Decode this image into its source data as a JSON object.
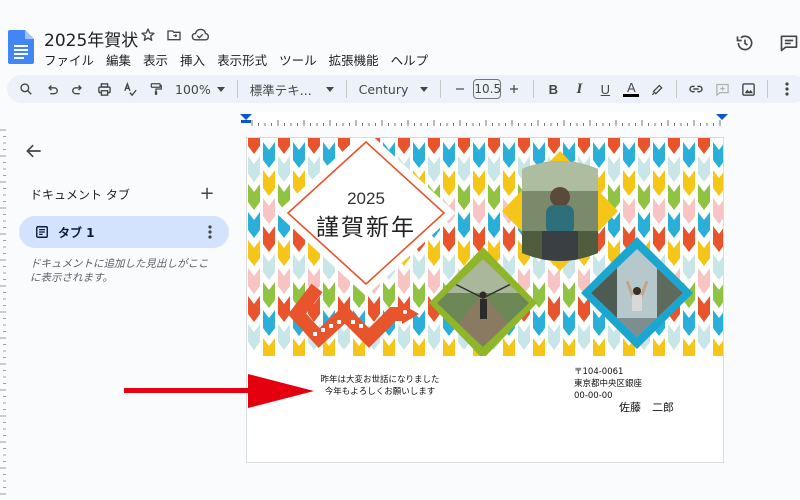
{
  "doc": {
    "title": "2025年賀状",
    "menus": [
      "ファイル",
      "編集",
      "表示",
      "挿入",
      "表示形式",
      "ツール",
      "拡張機能",
      "ヘルプ"
    ],
    "title_icons": [
      "star-icon",
      "move-to-folder-icon",
      "cloud-saved-icon"
    ],
    "right_icons": [
      "history-icon",
      "comments-icon"
    ]
  },
  "toolbar": {
    "zoom": "100%",
    "style": "標準テキ...",
    "font": "Century",
    "font_size": "10.5",
    "bold": "B",
    "italic": "I",
    "underline": "U",
    "text_color": "A",
    "text_color_value": "#000000",
    "icons": [
      "search-icon",
      "undo-icon",
      "redo-icon",
      "print-icon",
      "spellcheck-icon",
      "paint-format-icon",
      "highlight-icon",
      "link-icon",
      "add-comment-icon",
      "insert-image-icon",
      "more-icon"
    ]
  },
  "sidebar": {
    "header": "ドキュメント タブ",
    "add": "+",
    "tab_label": "タブ 1",
    "hint": "ドキュメントに追加した見出しがここに表示されます。"
  },
  "card": {
    "year": "2025",
    "greeting": "謹賀新年",
    "message_lines": [
      "昨年は大変お世話になりました",
      "今年もよろしくお願いします"
    ],
    "postal": "〒104-0061",
    "address": "東京都中央区銀座",
    "address_num": "00-00-00",
    "sender": "佐藤　二郎"
  },
  "colors": {
    "accent_blue": "#0b57d0",
    "arrow_red": "#e5000f",
    "pattern": [
      "#e8542c",
      "#f7c3c3",
      "#f5c518",
      "#2ab0d8",
      "#8fc341",
      "#c8e6e8"
    ]
  }
}
